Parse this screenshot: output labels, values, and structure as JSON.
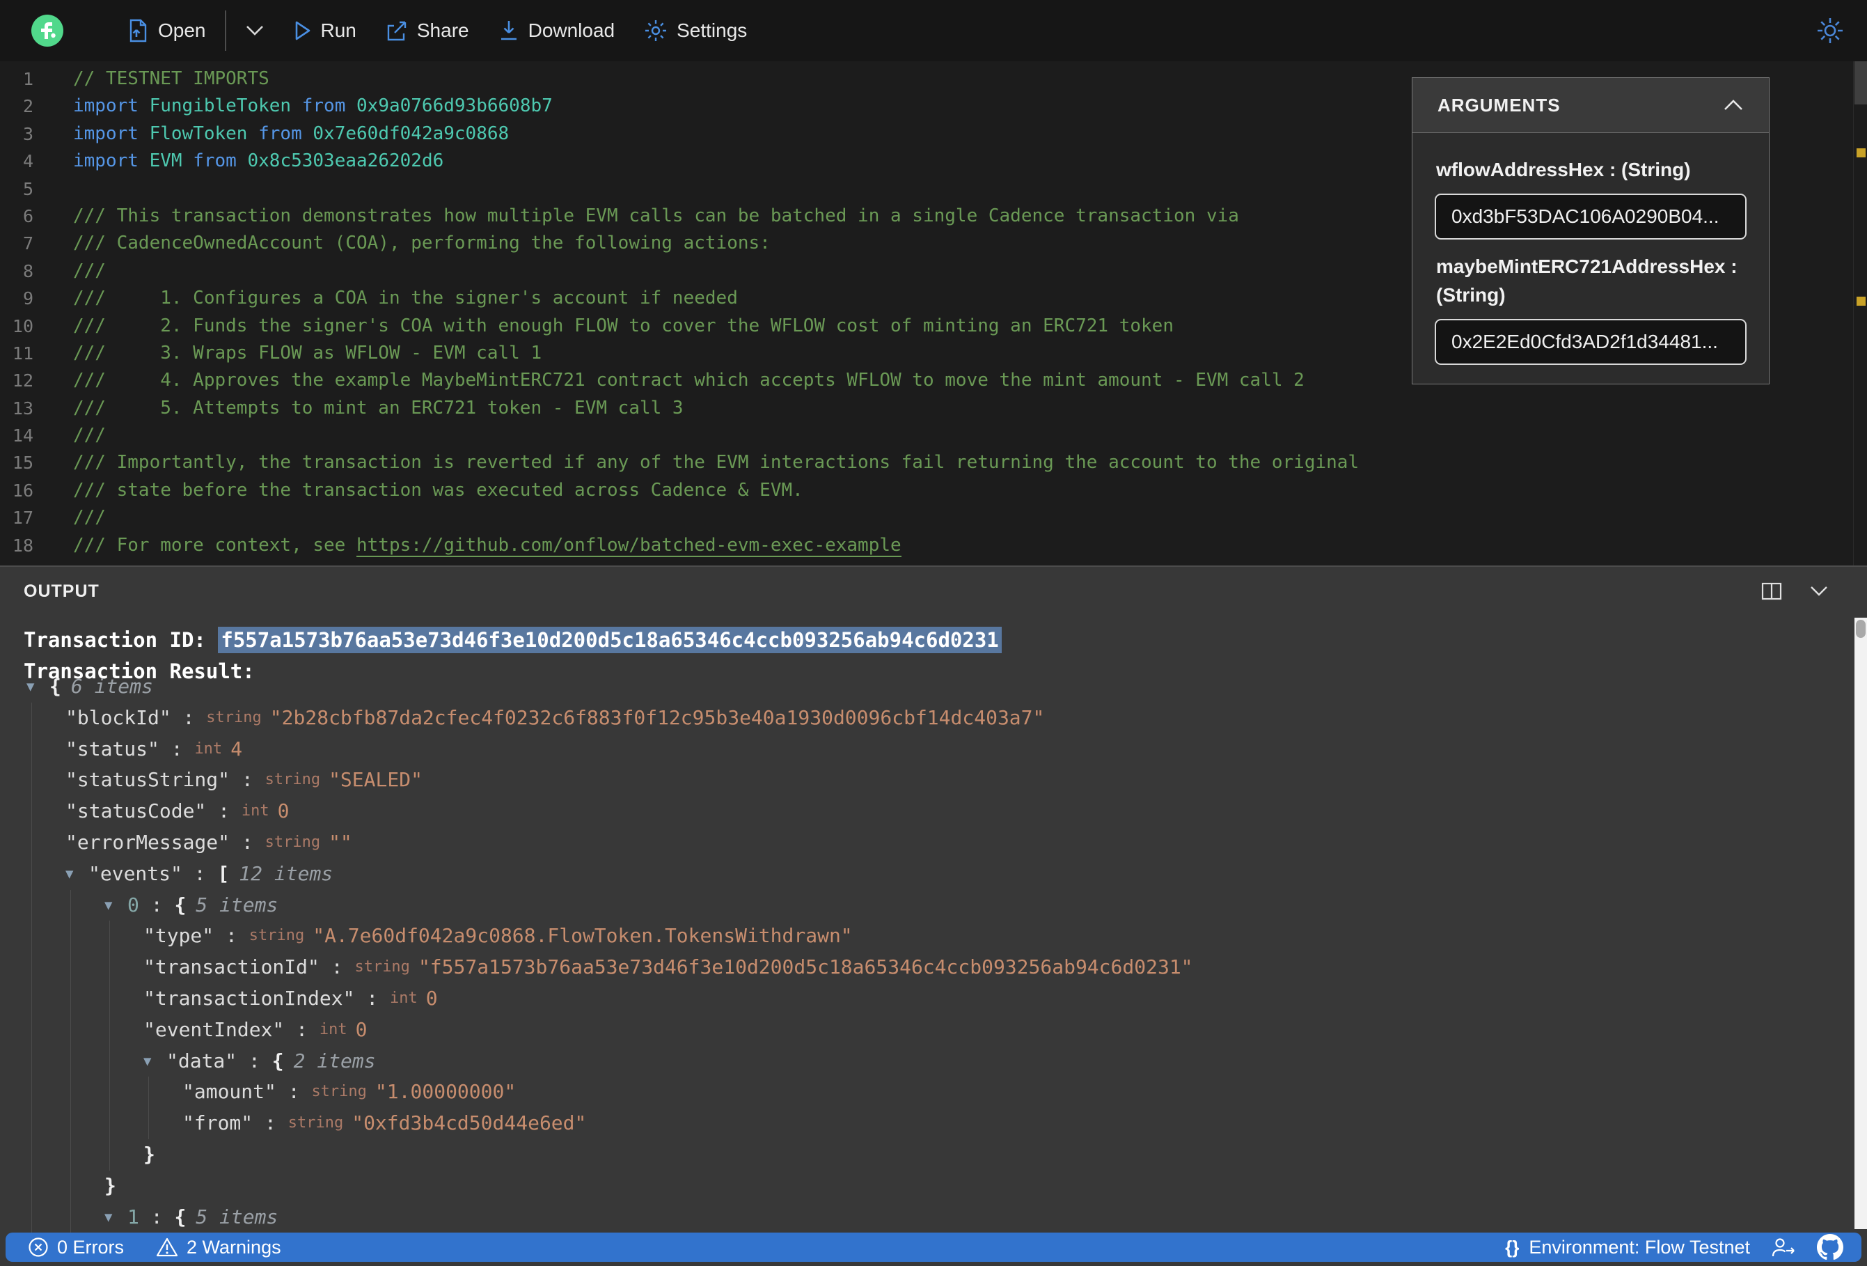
{
  "toolbar": {
    "open": "Open",
    "run": "Run",
    "share": "Share",
    "download": "Download",
    "settings": "Settings"
  },
  "editor": {
    "lines": [
      {
        "n": "1",
        "tokens": [
          [
            "cm",
            "// TESTNET IMPORTS"
          ]
        ]
      },
      {
        "n": "2",
        "tokens": [
          [
            "kw",
            "import "
          ],
          [
            "id",
            "FungibleToken "
          ],
          [
            "kw",
            "from "
          ],
          [
            "id",
            "0x9a0766d93b6608b7"
          ]
        ]
      },
      {
        "n": "3",
        "tokens": [
          [
            "kw",
            "import "
          ],
          [
            "id",
            "FlowToken "
          ],
          [
            "kw",
            "from "
          ],
          [
            "id",
            "0x7e60df042a9c0868"
          ]
        ]
      },
      {
        "n": "4",
        "tokens": [
          [
            "kw",
            "import "
          ],
          [
            "id",
            "EVM "
          ],
          [
            "kw",
            "from "
          ],
          [
            "id",
            "0x8c5303eaa26202d6"
          ]
        ]
      },
      {
        "n": "5",
        "tokens": []
      },
      {
        "n": "6",
        "tokens": [
          [
            "cm",
            "/// This transaction demonstrates how multiple EVM calls can be batched in a single Cadence transaction via"
          ]
        ]
      },
      {
        "n": "7",
        "tokens": [
          [
            "cm",
            "/// CadenceOwnedAccount (COA), performing the following actions:"
          ]
        ]
      },
      {
        "n": "8",
        "tokens": [
          [
            "cm",
            "///"
          ]
        ]
      },
      {
        "n": "9",
        "tokens": [
          [
            "cm",
            "///     1. Configures a COA in the signer's account if needed"
          ]
        ]
      },
      {
        "n": "10",
        "tokens": [
          [
            "cm",
            "///     2. Funds the signer's COA with enough FLOW to cover the WFLOW cost of minting an ERC721 token"
          ]
        ]
      },
      {
        "n": "11",
        "tokens": [
          [
            "cm",
            "///     3. Wraps FLOW as WFLOW - EVM call 1"
          ]
        ]
      },
      {
        "n": "12",
        "tokens": [
          [
            "cm",
            "///     4. Approves the example MaybeMintERC721 contract which accepts WFLOW to move the mint amount - EVM call 2"
          ]
        ]
      },
      {
        "n": "13",
        "tokens": [
          [
            "cm",
            "///     5. Attempts to mint an ERC721 token - EVM call 3"
          ]
        ]
      },
      {
        "n": "14",
        "tokens": [
          [
            "cm",
            "///"
          ]
        ]
      },
      {
        "n": "15",
        "tokens": [
          [
            "cm",
            "/// Importantly, the transaction is reverted if any of the EVM interactions fail returning the account to the original"
          ]
        ]
      },
      {
        "n": "16",
        "tokens": [
          [
            "cm",
            "/// state before the transaction was executed across Cadence & EVM."
          ]
        ]
      },
      {
        "n": "17",
        "tokens": [
          [
            "cm",
            "///"
          ]
        ]
      },
      {
        "n": "18",
        "tokens": [
          [
            "cm",
            "/// For more context, see "
          ],
          [
            "lk",
            "https://github.com/onflow/batched-evm-exec-example"
          ]
        ]
      }
    ]
  },
  "arguments_panel": {
    "title": "ARGUMENTS",
    "fields": [
      {
        "label": "wflowAddressHex : (String)",
        "value": "0xd3bF53DAC106A0290B04..."
      },
      {
        "label": "maybeMintERC721AddressHex : (String)",
        "value": "0x2E2Ed0Cfd3AD2f1d34481..."
      }
    ]
  },
  "output": {
    "title": "OUTPUT",
    "transaction_id_label": "Transaction ID: ",
    "transaction_id": "f557a1573b76aa53e73d46f3e10d200d5c18a65346c4ccb093256ab94c6d0231",
    "transaction_result_label": "Transaction Result:",
    "rows": [
      {
        "indent": 0,
        "exp": true,
        "bracket": "{",
        "count": "6 items"
      },
      {
        "indent": 1,
        "key": "blockId",
        "vtype": "string",
        "value": "2b28cbfb87da2cfec4f0232c6f883f0f12c95b3e40a1930d0096cbf14dc403a7"
      },
      {
        "indent": 1,
        "key": "status",
        "vtype": "int",
        "value": "4"
      },
      {
        "indent": 1,
        "key": "statusString",
        "vtype": "string",
        "value": "SEALED"
      },
      {
        "indent": 1,
        "key": "statusCode",
        "vtype": "int",
        "value": "0"
      },
      {
        "indent": 1,
        "key": "errorMessage",
        "vtype": "string",
        "value": ""
      },
      {
        "indent": 1,
        "exp": true,
        "key": "events",
        "bracket": "[",
        "count": "12 items"
      },
      {
        "indent": 2,
        "exp": true,
        "index": "0",
        "bracket": "{",
        "count": "5 items"
      },
      {
        "indent": 3,
        "key": "type",
        "vtype": "string",
        "value": "A.7e60df042a9c0868.FlowToken.TokensWithdrawn"
      },
      {
        "indent": 3,
        "key": "transactionId",
        "vtype": "string",
        "value": "f557a1573b76aa53e73d46f3e10d200d5c18a65346c4ccb093256ab94c6d0231"
      },
      {
        "indent": 3,
        "key": "transactionIndex",
        "vtype": "int",
        "value": "0"
      },
      {
        "indent": 3,
        "key": "eventIndex",
        "vtype": "int",
        "value": "0"
      },
      {
        "indent": 3,
        "exp": true,
        "key": "data",
        "bracket": "{",
        "count": "2 items"
      },
      {
        "indent": 4,
        "key": "amount",
        "vtype": "string",
        "value": "1.00000000"
      },
      {
        "indent": 4,
        "key": "from",
        "vtype": "string",
        "value": "0xfd3b4cd50d44e6ed"
      },
      {
        "indent": 3,
        "close": "}"
      },
      {
        "indent": 2,
        "close": "}"
      },
      {
        "indent": 2,
        "exp": true,
        "index": "1",
        "bracket": "{",
        "count": "5 items"
      }
    ]
  },
  "statusbar": {
    "errors": "0 Errors",
    "warnings": "2 Warnings",
    "braces": "{}",
    "environment": "Environment: Flow Testnet"
  }
}
